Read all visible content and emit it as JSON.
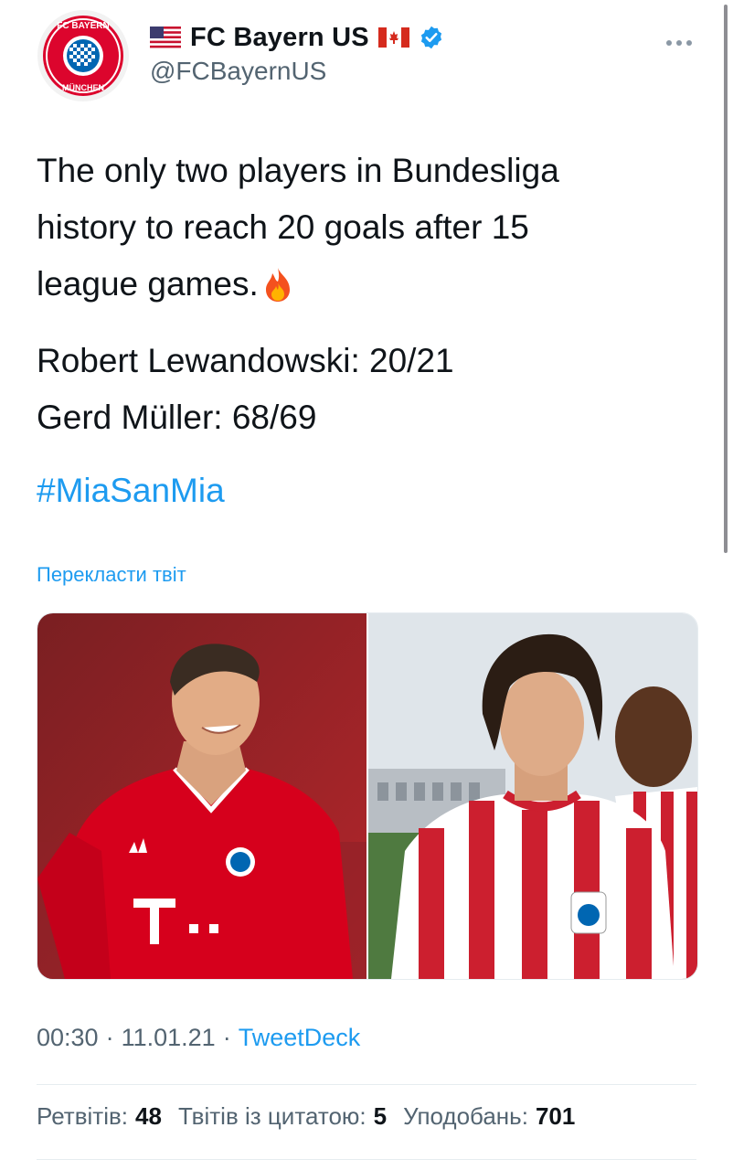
{
  "tweet": {
    "author": {
      "display_name": "FC Bayern US",
      "handle": "@FCBayernUS",
      "verified": true,
      "avatar_icon": "fc-bayern-crest",
      "logo_text": [
        "FC BAYERN",
        "MÜNCHEN"
      ],
      "flags": [
        "us-flag-icon",
        "canada-flag-icon"
      ]
    },
    "more_icon": "more-icon",
    "text_lines": [
      "The only two players in Bundesliga",
      "history to reach 20 goals after 15",
      "league games."
    ],
    "fire_icon": "fire-emoji-icon",
    "stat_lines": [
      "Robert Lewandowski: 20/21",
      "Gerd Müller: 68/69"
    ],
    "hashtag": "#MiaSanMia",
    "translate_label": "Перекласти твіт",
    "media": [
      {
        "name": "photo-lewandowski",
        "jersey_color": "#d6001c"
      },
      {
        "name": "photo-muller",
        "jersey_color": "#cc1f2f"
      }
    ],
    "meta": {
      "time": "00:30",
      "separator": "·",
      "date": "11.01.21",
      "source": "TweetDeck"
    },
    "stats": {
      "retweets_label": "Ретвітів:",
      "retweets": "48",
      "quotes_label": "Твітів із цитатою:",
      "quotes": "5",
      "likes_label": "Уподобань:",
      "likes": "701"
    }
  },
  "colors": {
    "accent": "#1d9bf0",
    "text": "#0f1419",
    "secondary": "#536471",
    "bayern_red": "#dc052d",
    "bayern_blue": "#0066b2"
  }
}
